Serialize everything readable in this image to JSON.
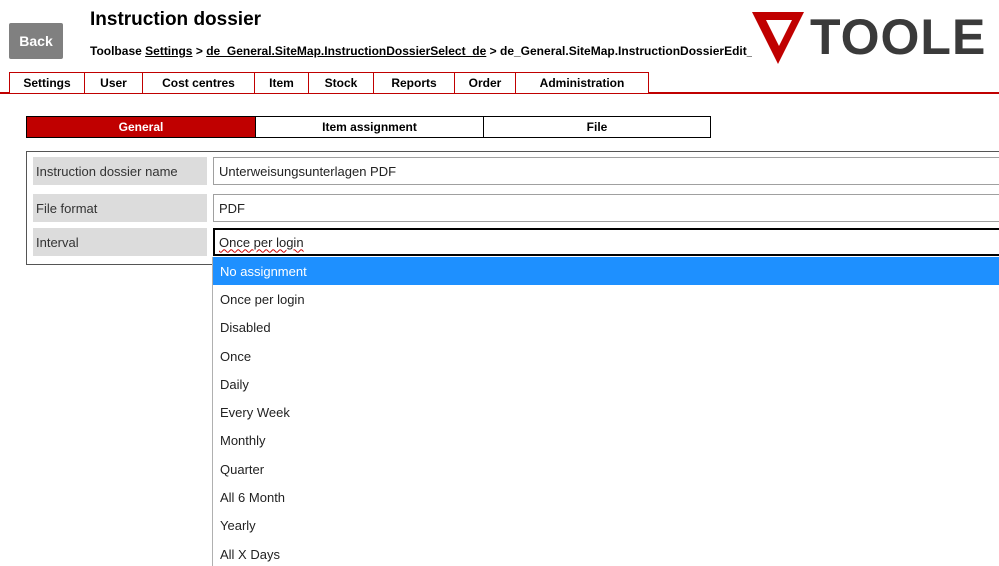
{
  "header": {
    "back_label": "Back",
    "title": "Instruction dossier",
    "breadcrumb": {
      "prefix": "Toolbase",
      "link1": "Settings",
      "sep1": ">",
      "link2": "de_General.SiteMap.InstructionDossierSelect_de",
      "sep2": ">",
      "current": "de_General.SiteMap.InstructionDossierEdit_de"
    },
    "logo_text": "TOOLE"
  },
  "nav": {
    "items": [
      {
        "label": "Settings"
      },
      {
        "label": "User"
      },
      {
        "label": "Cost centres"
      },
      {
        "label": "Item"
      },
      {
        "label": "Stock"
      },
      {
        "label": "Reports"
      },
      {
        "label": "Order"
      },
      {
        "label": "Administration"
      }
    ]
  },
  "tabs": [
    {
      "label": "General",
      "active": true
    },
    {
      "label": "Item assignment",
      "active": false
    },
    {
      "label": "File",
      "active": false
    }
  ],
  "form": {
    "name_label": "Instruction dossier name",
    "name_value": "Unterweisungsunterlagen PDF",
    "format_label": "File format",
    "format_value": "PDF",
    "interval_label": "Interval",
    "interval_value": "Once per login"
  },
  "dropdown": {
    "options": [
      "No assignment",
      "Once per login",
      "Disabled",
      "Once",
      "Daily",
      "Every Week",
      "Monthly",
      "Quarter",
      "All 6 Month",
      "Yearly",
      "All X Days"
    ],
    "highlighted_index": 0
  },
  "colors": {
    "brand_red": "#c00000",
    "highlight_blue": "#1e90ff",
    "back_button_gray": "#808080",
    "label_bg": "#dcdcdc"
  }
}
